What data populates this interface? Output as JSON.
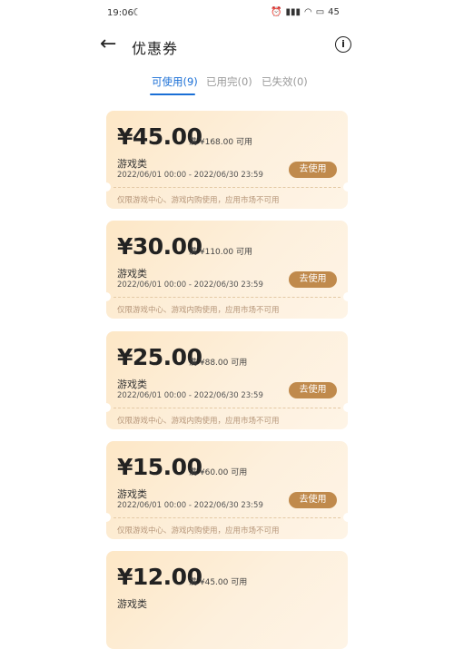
{
  "status_bar": {
    "time": "19:06",
    "battery": "45"
  },
  "header": {
    "title": "优惠券"
  },
  "tabs": [
    {
      "label": "可使用(9)",
      "active": true
    },
    {
      "label": "已用完(0)",
      "active": false
    },
    {
      "label": "已失效(0)",
      "active": false
    }
  ],
  "coupons": [
    {
      "amount": "¥45.00",
      "condition": "满 ¥168.00 可用",
      "category": "游戏类",
      "validity": "2022/06/01 00:00 - 2022/06/30 23:59",
      "button": "去使用",
      "note": "仅限游戏中心、游戏内购使用，应用市场不可用"
    },
    {
      "amount": "¥30.00",
      "condition": "满 ¥110.00 可用",
      "category": "游戏类",
      "validity": "2022/06/01 00:00 - 2022/06/30 23:59",
      "button": "去使用",
      "note": "仅限游戏中心、游戏内购使用，应用市场不可用"
    },
    {
      "amount": "¥25.00",
      "condition": "满 ¥88.00 可用",
      "category": "游戏类",
      "validity": "2022/06/01 00:00 - 2022/06/30 23:59",
      "button": "去使用",
      "note": "仅限游戏中心、游戏内购使用，应用市场不可用"
    },
    {
      "amount": "¥15.00",
      "condition": "满 ¥60.00 可用",
      "category": "游戏类",
      "validity": "2022/06/01 00:00 - 2022/06/30 23:59",
      "button": "去使用",
      "note": "仅限游戏中心、游戏内购使用，应用市场不可用"
    },
    {
      "amount": "¥12.00",
      "condition": "满 ¥45.00 可用",
      "category": "游戏类",
      "validity": "",
      "button": "",
      "note": ""
    }
  ],
  "colors": {
    "accent": "#1a6fd6",
    "button": "#c08a4c",
    "coupon_bg": "#fde7c6"
  }
}
